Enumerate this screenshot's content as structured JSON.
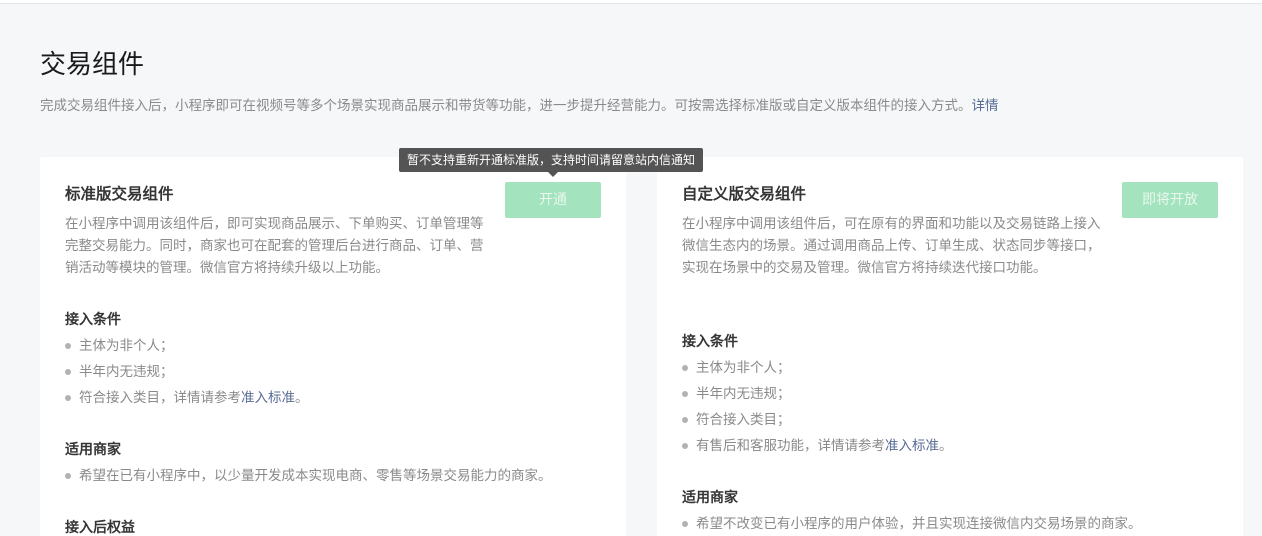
{
  "page": {
    "title": "交易组件",
    "desc": "完成交易组件接入后，小程序即可在视频号等多个场景实现商品展示和带货等功能，进一步提升经营能力。可按需选择标准版或自定义版本组件的接入方式。",
    "desc_link": "详情"
  },
  "tooltip": {
    "text": "暂不支持重新开通标准版，支持时间请留意站内信通知"
  },
  "standard": {
    "title": "标准版交易组件",
    "button": "开通",
    "desc": "在小程序中调用该组件后，即可实现商品展示、下单购买、订单管理等完整交易能力。同时，商家也可在配套的管理后台进行商品、订单、营销活动等模块的管理。微信官方将持续升级以上功能。",
    "conditions_title": "接入条件",
    "conditions": [
      "主体为非个人；",
      "半年内无违规；",
      "符合接入类目，详情请参考"
    ],
    "conditions_link": "准入标准",
    "conditions_link_tail": "。",
    "merchants_title": "适用商家",
    "merchants": [
      "希望在已有小程序中，以少量开发成本实现电商、零售等场景交易能力的商家。"
    ],
    "benefits_title": "接入后权益"
  },
  "custom": {
    "title": "自定义版交易组件",
    "button": "即将开放",
    "desc": "在小程序中调用该组件后，可在原有的界面和功能以及交易链路上接入微信生态内的场景。通过调用商品上传、订单生成、状态同步等接口，实现在场景中的交易及管理。微信官方将持续迭代接口功能。",
    "conditions_title": "接入条件",
    "conditions": [
      "主体为非个人；",
      "半年内无违规；",
      "符合接入类目；",
      "有售后和客服功能，详情请参考"
    ],
    "conditions_link": "准入标准",
    "conditions_link_tail": "。",
    "merchants_title": "适用商家",
    "merchants": [
      "希望不改变已有小程序的用户体验，并且实现连接微信内交易场景的商家。"
    ]
  }
}
